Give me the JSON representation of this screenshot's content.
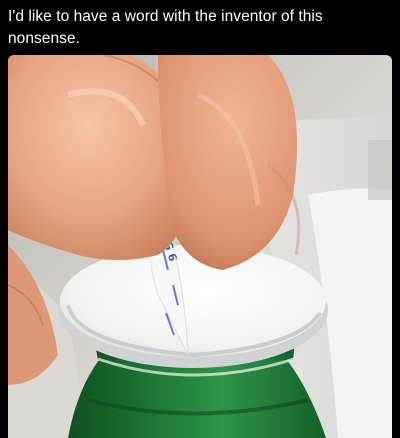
{
  "post": {
    "caption": "I'd like to have a word with the inventor of this nonsense."
  },
  "photo": {
    "subject": "thumb-and-finger-peeling-foil-seal-icon",
    "printed_text": "MEG 6"
  },
  "colors": {
    "background": "#000000",
    "caption_text": "#ffffff",
    "skin": "#e6a381",
    "skin_shadow": "#c77f5d",
    "foil_seal": "#f1f2f0",
    "bottle_green": "#1e7a36",
    "ink_blue": "#4a5ab8"
  }
}
